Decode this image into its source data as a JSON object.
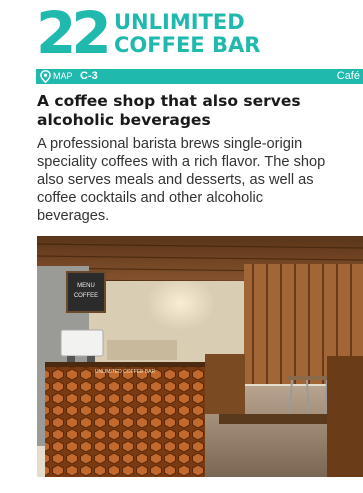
{
  "theme": {
    "accent": "#20b9ae"
  },
  "entry": {
    "number": "22",
    "title_line1": "UNLIMITED",
    "title_line2": "COFFEE BAR"
  },
  "location_bar": {
    "icon": "map-pin-icon",
    "map_label": "MAP",
    "map_code": "C-3",
    "category": "Café"
  },
  "article": {
    "headline_line1": "A coffee shop that also serves",
    "headline_line2": "alcoholic beverages",
    "body_lines": [
      "A professional barista brews single-origin",
      "speciality coffees with a rich flavor. The shop",
      "also serves meals and desserts, as well as",
      "coffee cocktails and other alcoholic",
      "beverages."
    ]
  },
  "photo": {
    "chalkboard_line1": "MENU",
    "chalkboard_line2": "COFFEE",
    "counter_sign": "UNLIMITED COFFEE BAR"
  }
}
